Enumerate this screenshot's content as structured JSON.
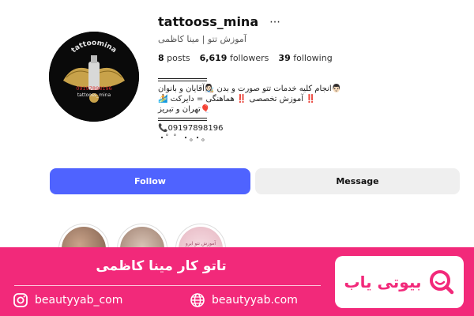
{
  "profile": {
    "username": "tattooss_mina",
    "more_icon": "⋯",
    "display_name": "آموزش تتو | مینا کاظمی",
    "stats": {
      "posts_count": "8",
      "posts_label": "posts",
      "followers_count": "6,619",
      "followers_label": "followers",
      "following_count": "39",
      "following_label": "following"
    },
    "avatar_text": {
      "top": "tattoomina",
      "phone": "09197898196",
      "handle": "tattooss_mina"
    },
    "bio": {
      "line1": "👨🏻انجام کلیه خدمات تتو صورت و بدن 👩🏻‍🎨آقایان و بانوان",
      "line2": "‼️ آموزش تخصصی ‼️ هماهنگی = دایرکت 🏄",
      "line3": "🎈تهران و تبریز",
      "phone_line": "📞09197898196",
      "dots_line": "・゜゜・。・。"
    }
  },
  "actions": {
    "follow_label": "Follow",
    "message_label": "Message"
  },
  "highlights": {
    "hl3_text": "آموزش تتو ابرو"
  },
  "banner": {
    "title": "تاتو کار مینا کاظمی",
    "instagram_label": "beautyyab_com",
    "website_label": "beautyyab.com",
    "logo_text": "بیوتی یاب",
    "brand_color": "#f2297a",
    "follow_button_color": "#4f63ff"
  },
  "icons": {
    "more": "more-options-icon",
    "instagram": "instagram-icon",
    "globe": "globe-icon",
    "logo": "beautyyab-logo-icon"
  }
}
